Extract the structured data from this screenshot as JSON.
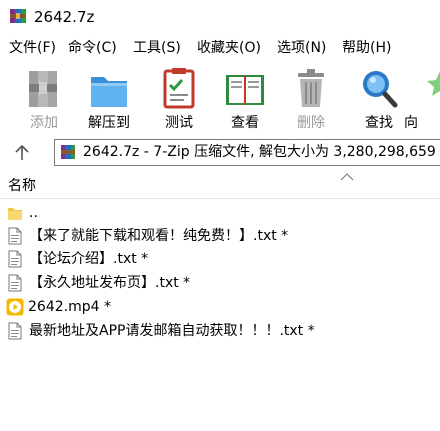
{
  "window": {
    "title": "2642.7z"
  },
  "menu": [
    "文件(F)",
    "命令(C)",
    "工具(S)",
    "收藏夹(O)",
    "选项(N)",
    "帮助(H)"
  ],
  "toolbar": [
    {
      "label": "添加",
      "icon": "add-archive-icon",
      "enabled": false
    },
    {
      "label": "解压到",
      "icon": "extract-folder-icon",
      "enabled": true
    },
    {
      "label": "测试",
      "icon": "test-checklist-icon",
      "enabled": true
    },
    {
      "label": "查看",
      "icon": "view-book-icon",
      "enabled": true
    },
    {
      "label": "删除",
      "icon": "trash-icon",
      "enabled": false
    },
    {
      "label": "查找",
      "icon": "magnifier-icon",
      "enabled": true
    },
    {
      "label": "向",
      "icon": "wizard-icon",
      "enabled": true
    }
  ],
  "address": {
    "text": "2642.7z - 7-Zip 压缩文件, 解包大小为 3,280,298,659"
  },
  "list": {
    "header": "名称",
    "rows": [
      {
        "name": "..",
        "type": "parent-folder"
      },
      {
        "name": "【来了就能下载和观看！纯免费！】.txt *",
        "type": "text"
      },
      {
        "name": "【论坛介绍】.txt *",
        "type": "text"
      },
      {
        "name": "【永久地址发布页】.txt *",
        "type": "text"
      },
      {
        "name": "2642.mp4 *",
        "type": "video"
      },
      {
        "name": "最新地址及APP请发邮箱自动获取！！！.txt *",
        "type": "text"
      }
    ]
  },
  "colors": {
    "folder": "#f3c54a",
    "video": "#f5b800",
    "disabled_text": "#9a9a9a"
  }
}
